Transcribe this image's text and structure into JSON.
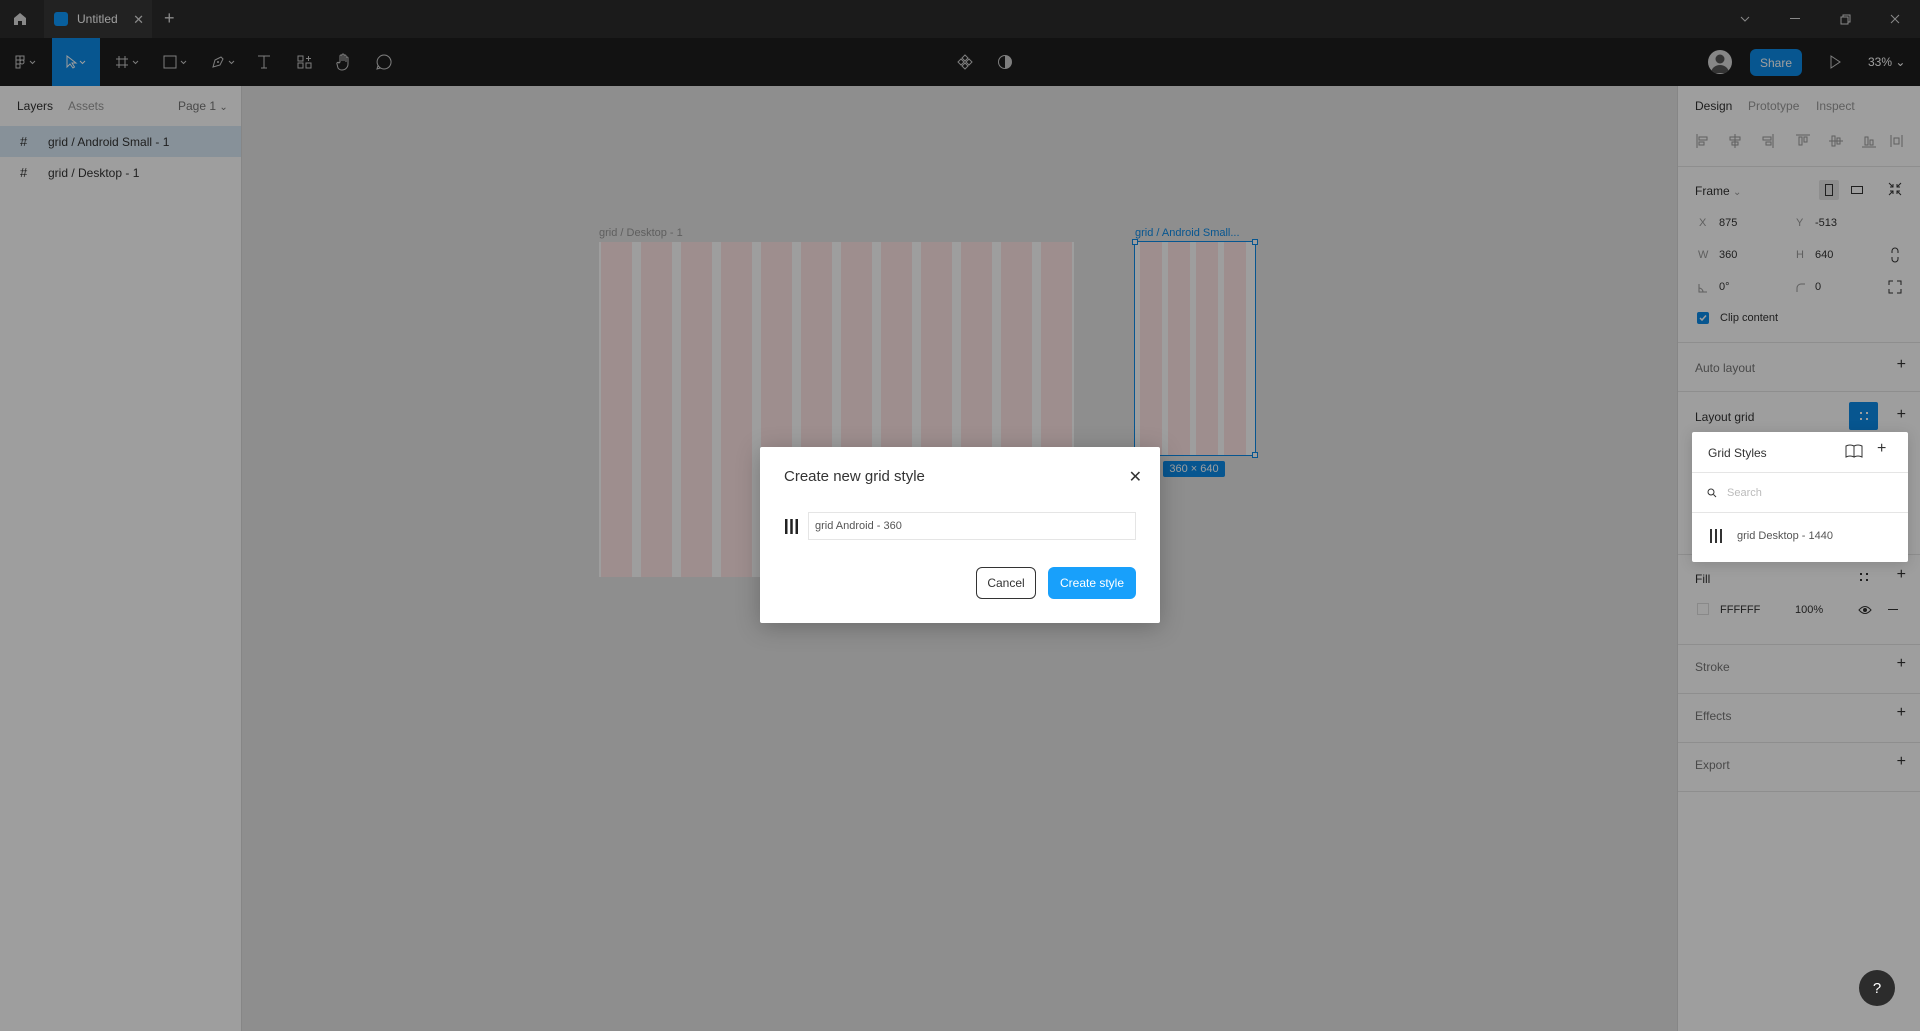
{
  "window": {
    "tab_title": "Untitled"
  },
  "toolbar": {
    "share_label": "Share",
    "zoom": "33%"
  },
  "left_panel": {
    "tabs": [
      "Layers",
      "Assets"
    ],
    "page": "Page 1",
    "layers": [
      {
        "label": "grid / Android Small - 1",
        "selected": true
      },
      {
        "label": "grid / Desktop - 1",
        "selected": false
      }
    ]
  },
  "canvas": {
    "desktop_frame_label": "grid / Desktop - 1",
    "android_frame_label": "grid / Android Small...",
    "size_badge": "360 × 640",
    "desktop_columns": 12,
    "android_columns": 4
  },
  "right_panel": {
    "tabs": [
      "Design",
      "Prototype",
      "Inspect"
    ],
    "frame_title": "Frame",
    "x_label": "X",
    "x_value": "875",
    "y_label": "Y",
    "y_value": "-513",
    "w_label": "W",
    "w_value": "360",
    "h_label": "H",
    "h_value": "640",
    "rotation": "0°",
    "radius": "0",
    "clip_content": "Clip content",
    "auto_layout": "Auto layout",
    "layout_grid": "Layout grid",
    "fill_title": "Fill",
    "fill_hex": "FFFFFF",
    "fill_opacity": "100%",
    "stroke": "Stroke",
    "effects": "Effects",
    "export": "Export"
  },
  "popover": {
    "title": "Grid Styles",
    "search_placeholder": "Search",
    "items": [
      "grid Desktop - 1440"
    ]
  },
  "modal": {
    "title": "Create new grid style",
    "input_value": "grid Android - 360",
    "cancel_label": "Cancel",
    "create_label": "Create style"
  },
  "help": {
    "label": "?"
  },
  "colors": {
    "accent": "#0c8ce9",
    "primary_button": "#18a0fb",
    "grid_column": "rgba(255,0,0,0.1)"
  }
}
